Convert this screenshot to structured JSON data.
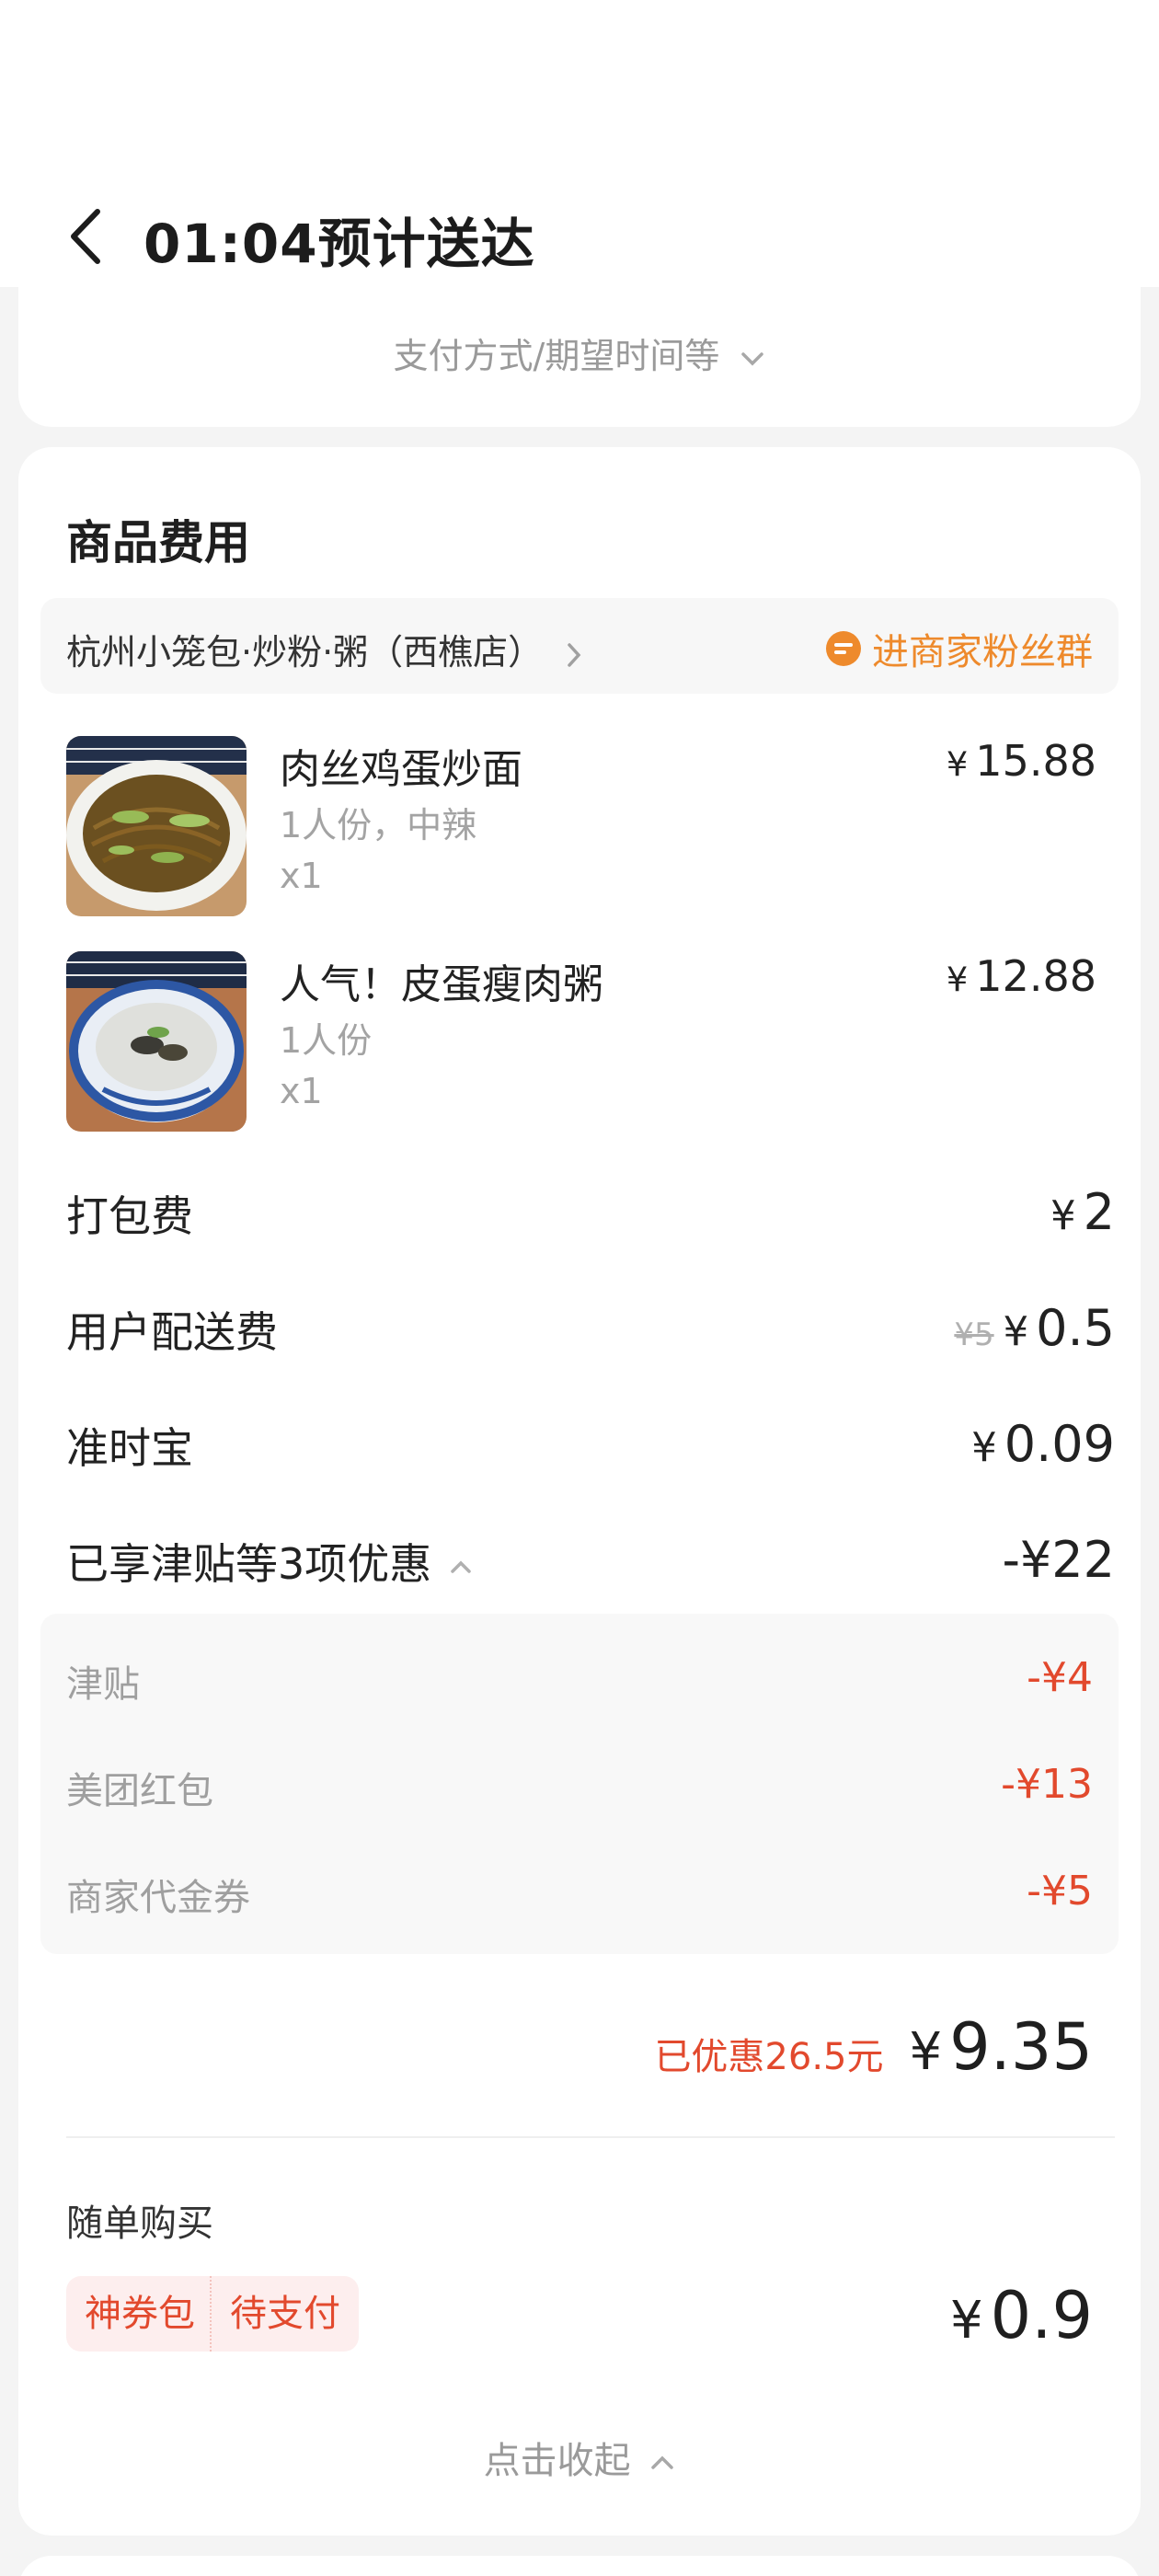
{
  "header": {
    "title": "01:04预计送达",
    "back_icon": "chevron-left-icon"
  },
  "top_card": {
    "pay_options": "支付方式/期望时间等",
    "chevron_icon": "chevron-down-icon"
  },
  "goods": {
    "section_title": "商品费用",
    "shop_name": "杭州小笼包·炒粉·粥（西樵店）",
    "fans_group": "进商家粉丝群",
    "items": [
      {
        "name": "肉丝鸡蛋炒面",
        "spec": "1人份，中辣",
        "qty": "x1",
        "currency": "¥",
        "price": "15.88",
        "image": "fried-noodles-photo"
      },
      {
        "name": "人气！皮蛋瘦肉粥",
        "spec": "1人份",
        "qty": "x1",
        "currency": "¥",
        "price": "12.88",
        "image": "congee-photo"
      }
    ]
  },
  "fees": {
    "packing": {
      "label": "打包费",
      "currency": "¥",
      "value": "2"
    },
    "delivery": {
      "label": "用户配送费",
      "original": "¥5",
      "currency": "¥",
      "value": "0.5"
    },
    "ontime": {
      "label": "准时宝",
      "currency": "¥",
      "value": "0.09"
    },
    "discount_summary": {
      "label": "已享津贴等3项优惠",
      "value": "-¥22"
    }
  },
  "discounts": [
    {
      "label": "津贴",
      "value": "-¥4"
    },
    {
      "label": "美团红包",
      "value": "-¥13"
    },
    {
      "label": "商家代金券",
      "value": "-¥5"
    }
  ],
  "total": {
    "saved": "已优惠26.5元",
    "currency": "¥",
    "amount": "9.35"
  },
  "addon": {
    "title": "随单购买",
    "tag1": "神券包",
    "tag2": "待支付",
    "currency": "¥",
    "price": "0.9"
  },
  "collapse_label": "点击收起",
  "colors": {
    "accent_red": "#e2492d",
    "accent_orange": "#ee8a2c",
    "muted": "#9a9a9a"
  }
}
